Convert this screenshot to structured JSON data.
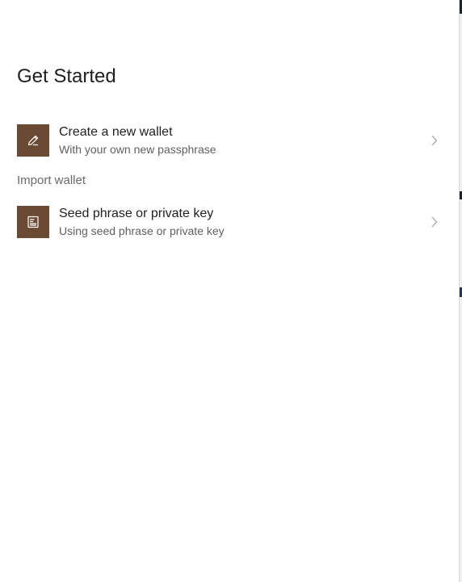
{
  "page": {
    "title": "Get Started"
  },
  "options": {
    "create": {
      "title": "Create a new wallet",
      "subtitle": "With your own new passphrase",
      "icon": "pencil-icon"
    },
    "import_section_label": "Import wallet",
    "import": {
      "title": "Seed phrase or private key",
      "subtitle": "Using seed phrase or private key",
      "icon": "document-icon"
    }
  },
  "colors": {
    "icon_background": "#6b4a33",
    "title_text": "#1f1f1f",
    "subtitle_text": "#5f5f5f",
    "section_label_text": "#6a6a6a",
    "chevron": "#a0a0a0"
  }
}
